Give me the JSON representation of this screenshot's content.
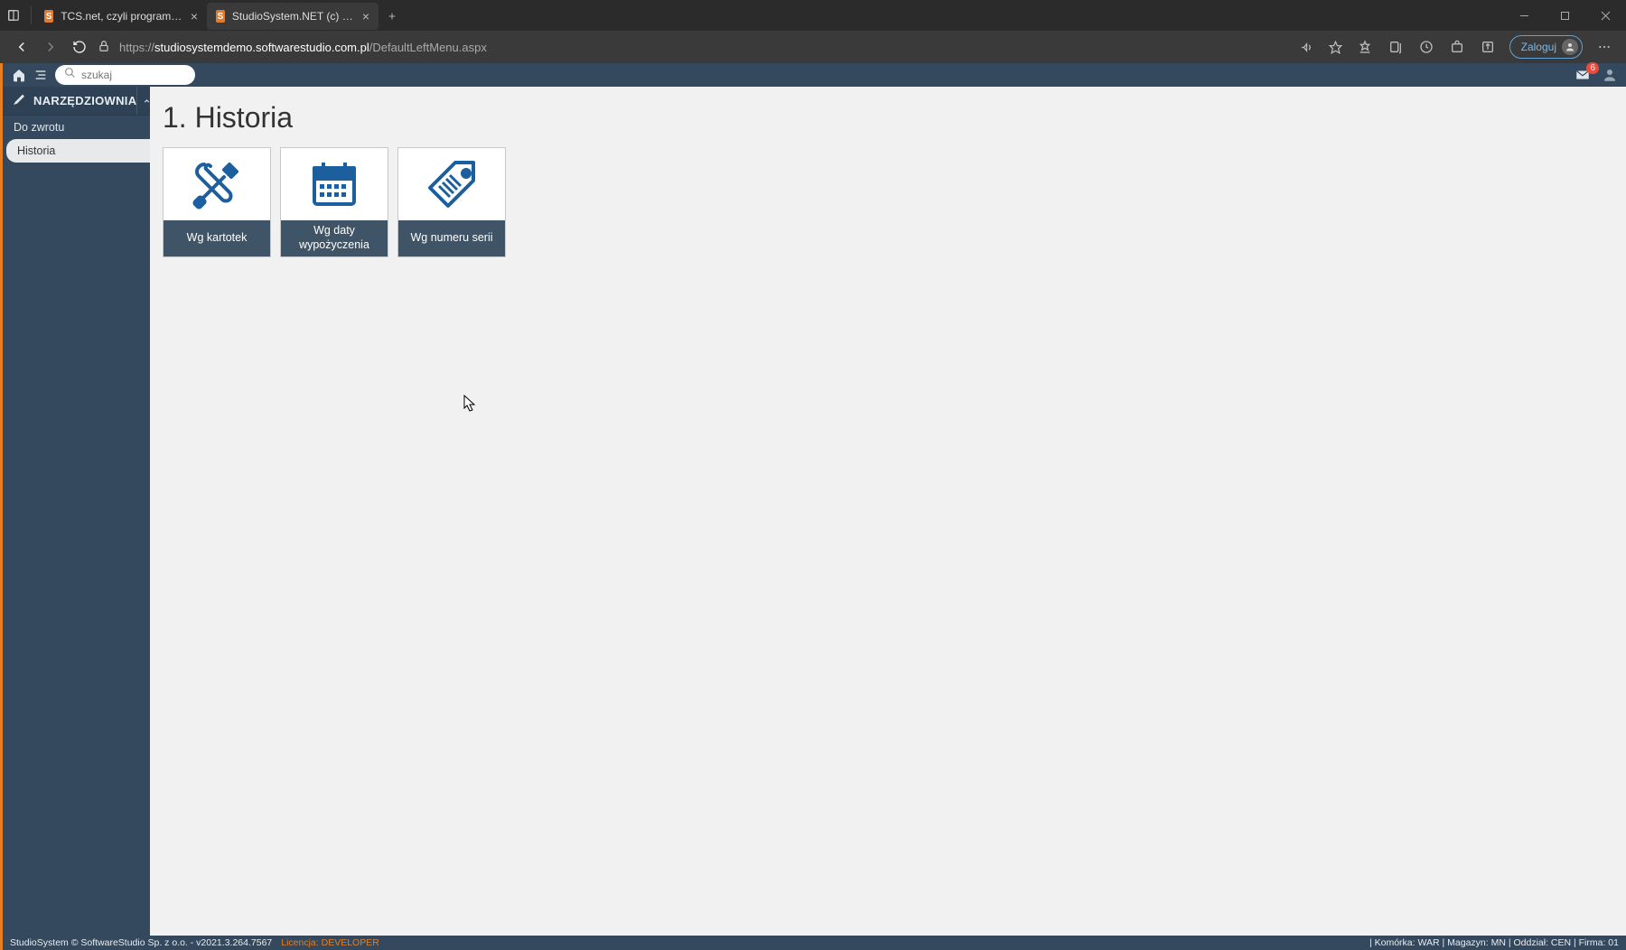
{
  "browser": {
    "tabs": [
      {
        "title": "TCS.net, czyli program w narzęd…"
      },
      {
        "title": "StudioSystem.NET (c) SoftwareSt…"
      }
    ],
    "url_prefix": "https://",
    "url_host": "studiosystemdemo.softwarestudio.com.pl",
    "url_path": "/DefaultLeftMenu.aspx",
    "login_label": "Zaloguj"
  },
  "app_header": {
    "search_placeholder": "szukaj",
    "mail_count": "6"
  },
  "sidebar": {
    "title": "NARZĘDZIOWNIA",
    "items": [
      {
        "label": "Do zwrotu",
        "active": false
      },
      {
        "label": "Historia",
        "active": true
      }
    ]
  },
  "page": {
    "title": "1. Historia",
    "tiles": [
      {
        "label": "Wg kartotek"
      },
      {
        "label": "Wg daty wypożyczenia"
      },
      {
        "label": "Wg numeru serii"
      }
    ]
  },
  "statusbar": {
    "left": "StudioSystem © SoftwareStudio Sp. z o.o. - v2021.3.264.7567",
    "license_label": "Licencja:",
    "license_value": "DEVELOPER",
    "right": "| Komórka: WAR | Magazyn: MN | Oddział: CEN | Firma: 01"
  }
}
